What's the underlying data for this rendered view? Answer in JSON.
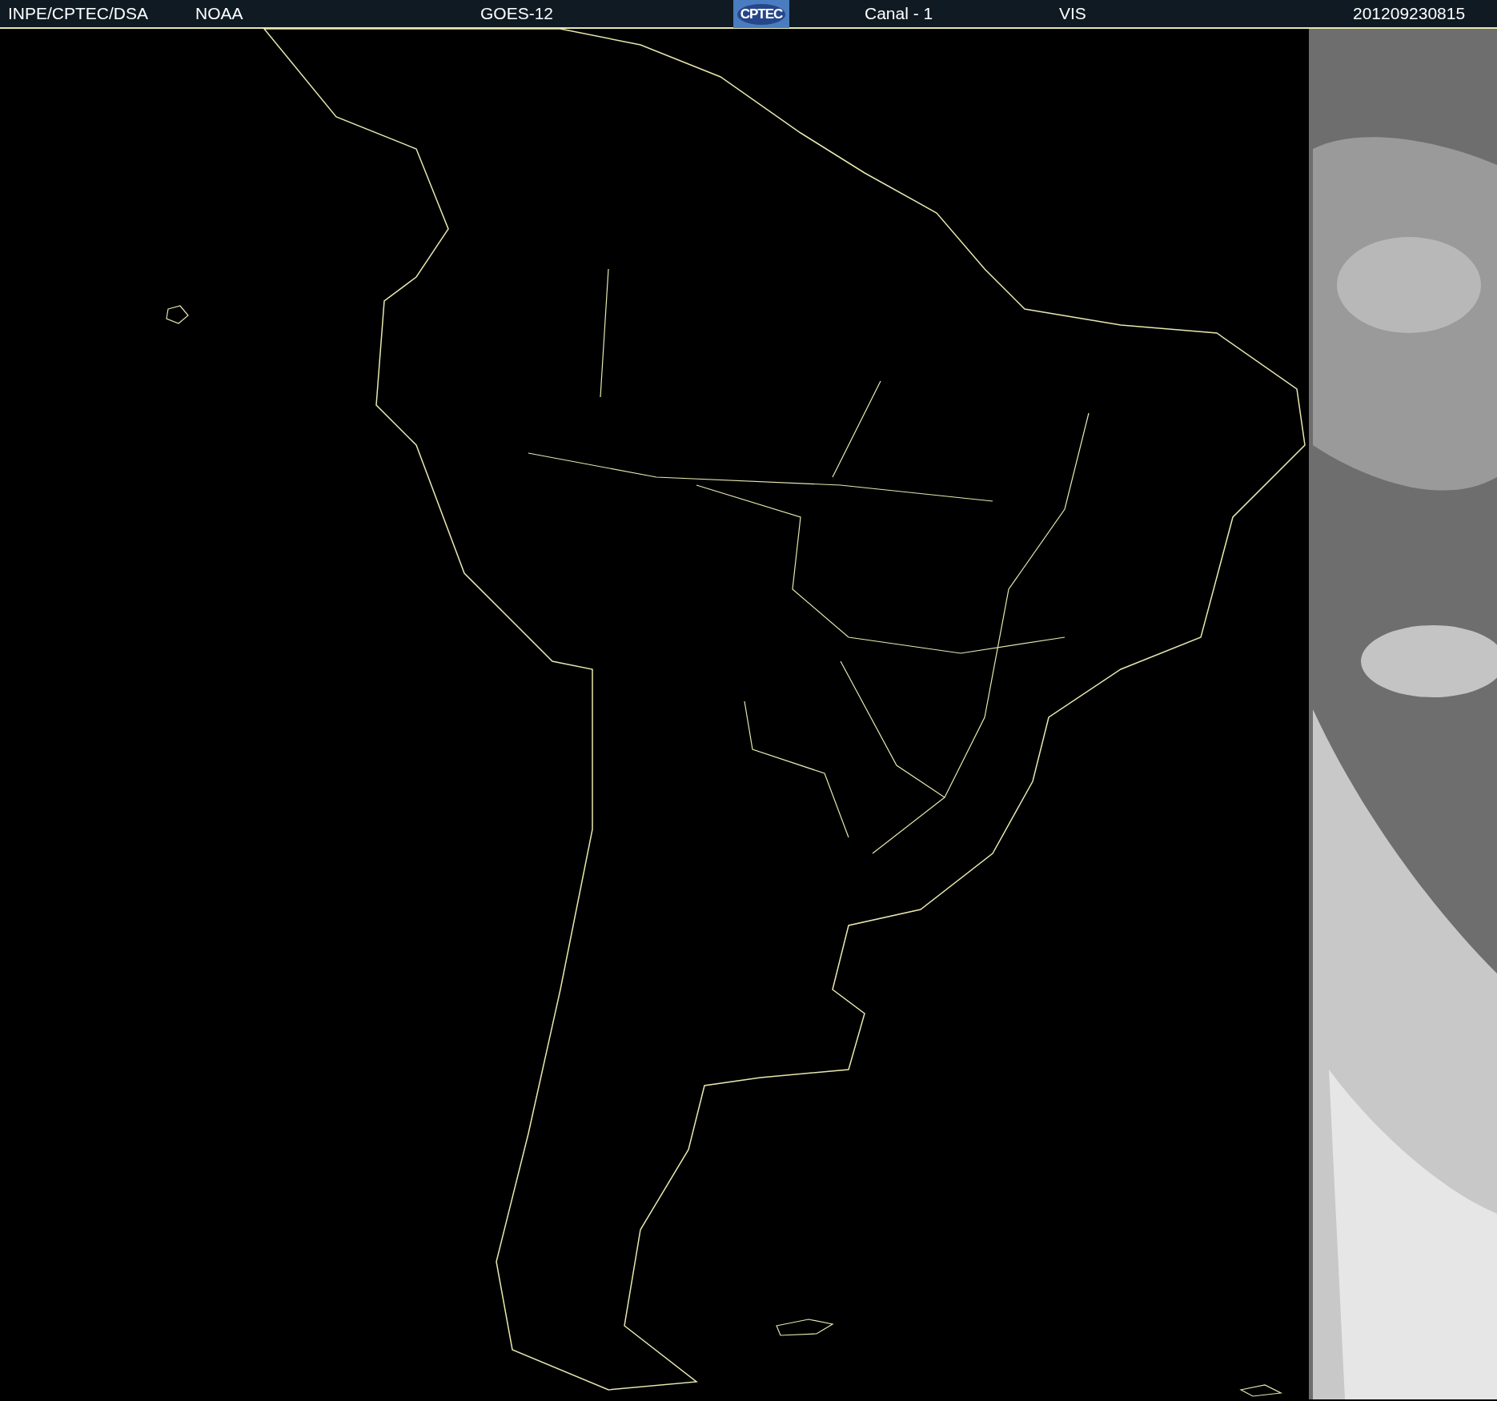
{
  "header": {
    "items": [
      {
        "kind": "text",
        "text": "INPE/CPTEC/DSA"
      },
      {
        "kind": "text",
        "text": "NOAA"
      },
      {
        "kind": "text",
        "text": "GOES-12"
      },
      {
        "kind": "logo",
        "text": "CPTEC"
      },
      {
        "kind": "text",
        "text": "Canal - 1"
      },
      {
        "kind": "text",
        "text": "VIS"
      },
      {
        "kind": "text",
        "text": "201209230815"
      }
    ]
  }
}
